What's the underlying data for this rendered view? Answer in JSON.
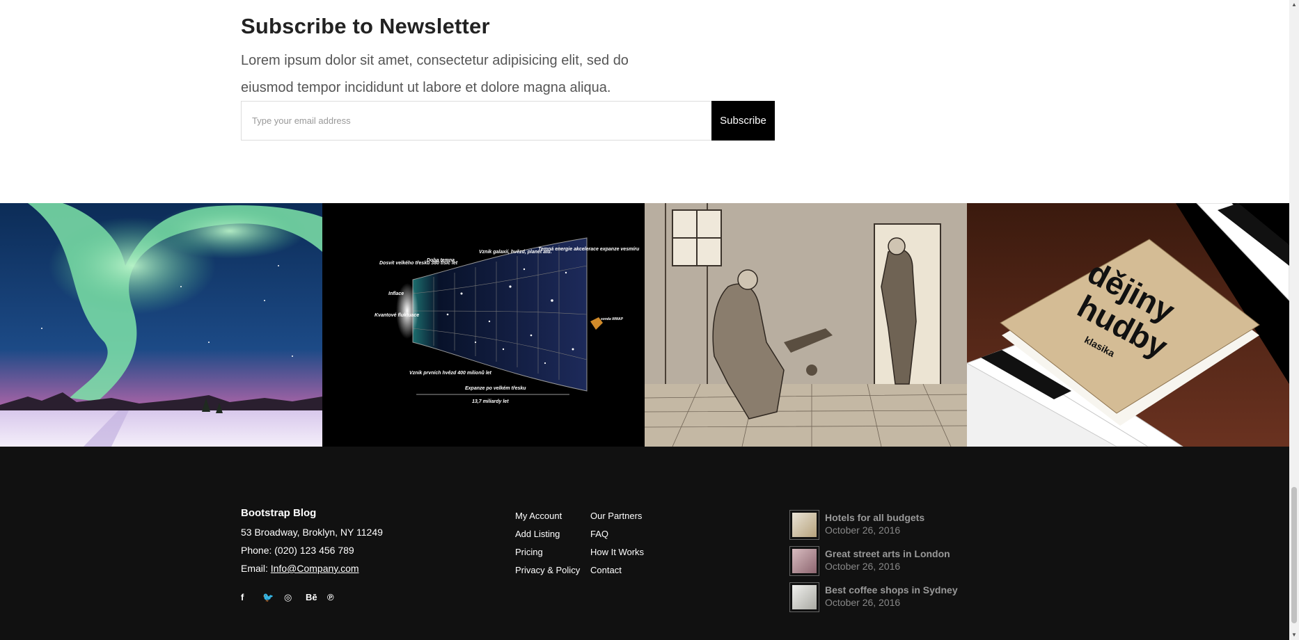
{
  "newsletter": {
    "title": "Subscribe to Newsletter",
    "text": "Lorem ipsum dolor sit amet, consectetur adipisicing elit, sed do eiusmod tempor incididunt ut labore et dolore magna aliqua.",
    "placeholder": "Type your email address",
    "button_label": "Subscribe"
  },
  "gallery": {
    "images": [
      {
        "name": "aurora-image"
      },
      {
        "name": "universe-diagram-image"
      },
      {
        "name": "engraving-image"
      },
      {
        "name": "book-piano-image"
      }
    ],
    "diagram_labels": {
      "a": "Dosvit velkého třesku 380 tisíc let",
      "b": "Doba temna",
      "c": "Vznik galaxií, hvězd, planet atd.",
      "d": "Temná energie akcelerace expanze vesmíru",
      "e": "Inflace",
      "f": "Kvantové fluktuace",
      "g": "Vznik prvních hvězd 400 milionů let",
      "h": "Expanze po velkém třesku",
      "i": "13,7 miliardy let",
      "j": "sonda WMAP"
    },
    "book_text": {
      "title1": "dějiny",
      "title2": "hudby",
      "sub": "klasika"
    }
  },
  "footer": {
    "brand": "Bootstrap Blog",
    "address": "53 Broadway, Broklyn, NY 11249",
    "phone": "Phone: (020) 123 456 789",
    "email_label": "Email: ",
    "email": "Info@Company.com",
    "social": [
      {
        "icon": "facebook-icon",
        "glyph": "f"
      },
      {
        "icon": "twitter-icon",
        "glyph": "🐦"
      },
      {
        "icon": "instagram-icon",
        "glyph": "◎"
      },
      {
        "icon": "behance-icon",
        "glyph": "Bē"
      },
      {
        "icon": "pinterest-icon",
        "glyph": "℗"
      }
    ],
    "links_col1": [
      "My Account",
      "Add Listing",
      "Pricing",
      "Privacy & Policy"
    ],
    "links_col2": [
      "Our Partners",
      "FAQ",
      "How It Works",
      "Contact"
    ],
    "posts": [
      {
        "title": "Hotels for all budgets",
        "date": "October 26, 2016",
        "thumb_color": "#cfc7b5"
      },
      {
        "title": "Great street arts in London",
        "date": "October 26, 2016",
        "thumb_color": "#b89aa0"
      },
      {
        "title": "Best coffee shops in Sydney",
        "date": "October 26, 2016",
        "thumb_color": "#d9d9d6"
      }
    ]
  }
}
